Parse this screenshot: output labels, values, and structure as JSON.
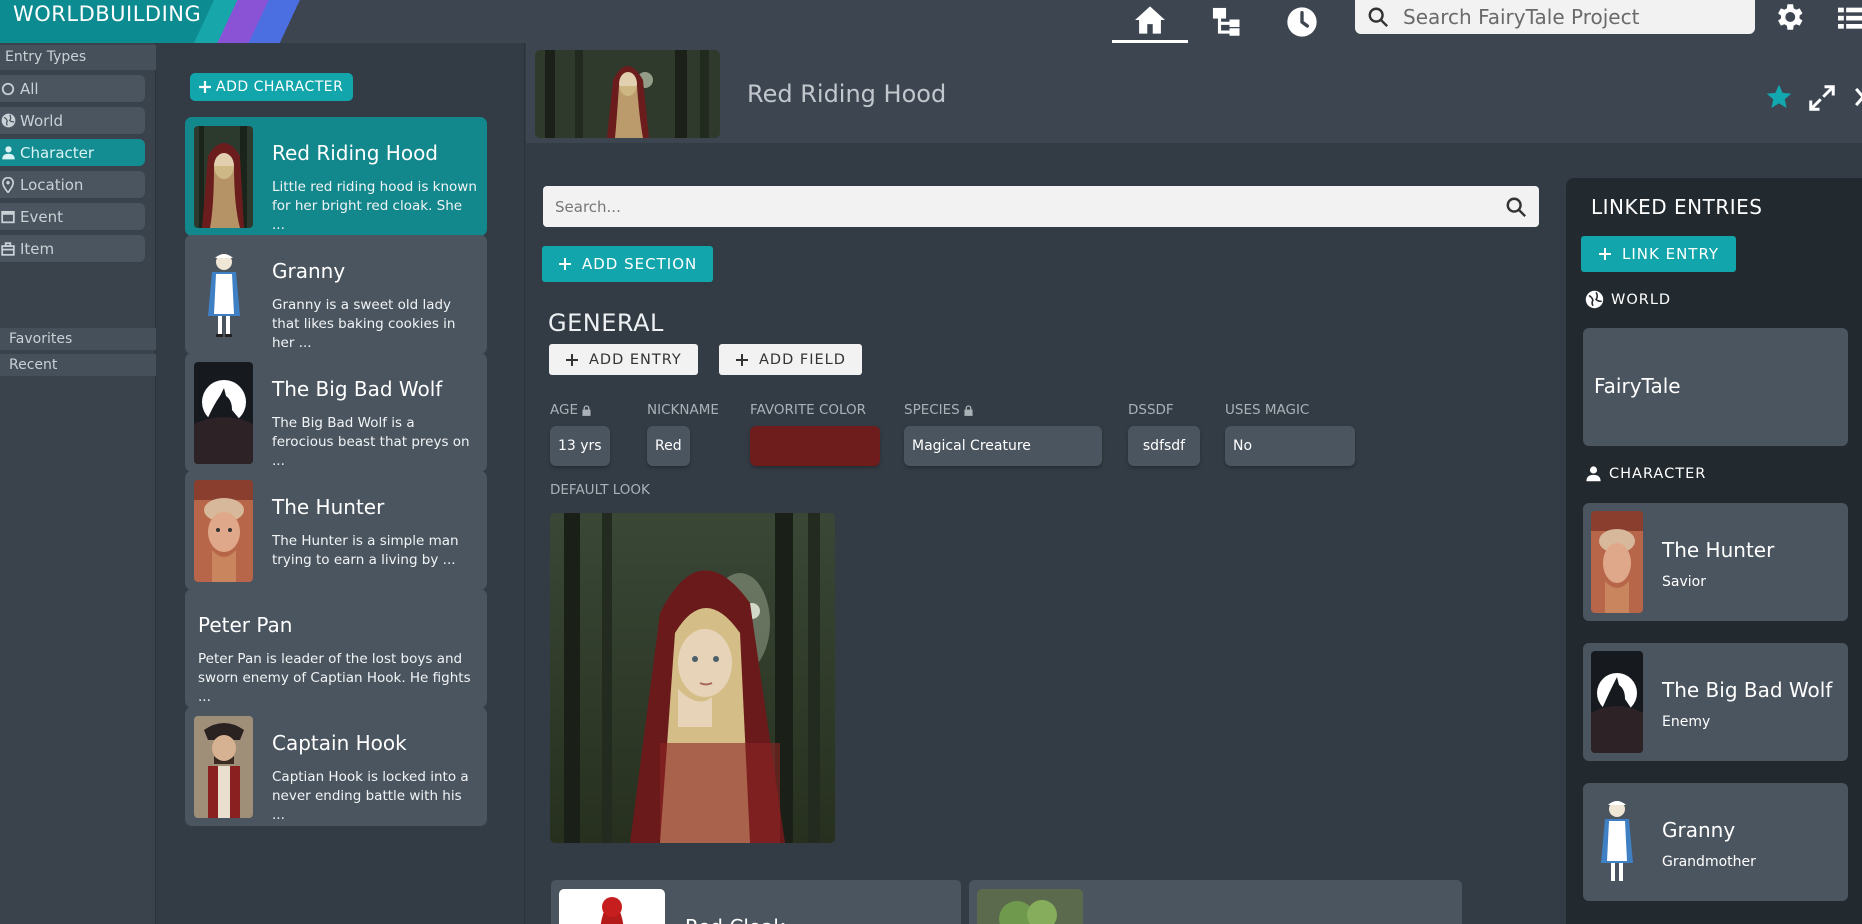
{
  "app": {
    "title": "WORLDBUILDING"
  },
  "topbar": {
    "nav": [
      {
        "name": "home",
        "icon": "home-icon"
      },
      {
        "name": "tree",
        "icon": "tree-icon"
      },
      {
        "name": "history",
        "icon": "clock-icon"
      }
    ],
    "search_placeholder": "Search FairyTale Project",
    "settings_icon": "gear-icon"
  },
  "sidebar": {
    "entry_types_label": "Entry Types",
    "types": [
      {
        "label": "All",
        "icon": "all-icon",
        "active": false
      },
      {
        "label": "World",
        "icon": "globe-icon",
        "active": false
      },
      {
        "label": "Character",
        "icon": "person-icon",
        "active": true
      },
      {
        "label": "Location",
        "icon": "pin-icon",
        "active": false
      },
      {
        "label": "Event",
        "icon": "calendar-icon",
        "active": false
      },
      {
        "label": "Item",
        "icon": "item-icon",
        "active": false
      }
    ],
    "favorites_label": "Favorites",
    "recent_label": "Recent"
  },
  "entries": {
    "add_button_label": "ADD CHARACTER",
    "items": [
      {
        "name": "Red Riding Hood",
        "desc": "Little red riding hood is known for her bright red cloak. She ...",
        "active": true
      },
      {
        "name": "Granny",
        "desc": "Granny is a sweet old lady that likes baking cookies in her ...",
        "active": false
      },
      {
        "name": "The Big Bad Wolf",
        "desc": "The Big Bad Wolf is a ferocious beast that preys on ...",
        "active": false
      },
      {
        "name": "The Hunter",
        "desc": "The Hunter is a simple man trying to earn a living by ...",
        "active": false
      },
      {
        "name": "Peter Pan",
        "desc": "Peter Pan is leader of the lost boys and sworn enemy of Captian Hook. He fights ...",
        "active": false
      },
      {
        "name": "Captain Hook",
        "desc": "Captian Hook is locked into a never ending battle with his ...",
        "active": false
      }
    ]
  },
  "entry": {
    "title": "Red Riding Hood",
    "search_placeholder": "Search...",
    "add_section_label": "ADD SECTION",
    "section": {
      "title": "GENERAL",
      "add_entry_label": "ADD ENTRY",
      "add_field_label": "ADD FIELD",
      "fields": [
        {
          "label": "AGE",
          "value": "13 yrs",
          "locked": true
        },
        {
          "label": "NICKNAME",
          "value": "Red",
          "locked": false
        },
        {
          "label": "FAVORITE COLOR",
          "value": "",
          "color": "#6e1c1c",
          "locked": false
        },
        {
          "label": "SPECIES",
          "value": "Magical Creature",
          "locked": true
        },
        {
          "label": "DSSDF",
          "value": "sdfsdf",
          "locked": false
        },
        {
          "label": "USES MAGIC",
          "value": "No",
          "locked": false
        }
      ],
      "default_look_label": "DEFAULT LOOK"
    },
    "bottom_items": [
      {
        "name": "Red Cloak"
      },
      {
        "name": ""
      }
    ]
  },
  "linked": {
    "title": "LINKED ENTRIES",
    "link_button_label": "LINK ENTRY",
    "world_label": "WORLD",
    "world": {
      "name": "FairyTale"
    },
    "character_label": "CHARACTER",
    "characters": [
      {
        "name": "The Hunter",
        "role": "Savior"
      },
      {
        "name": "The Big Bad Wolf",
        "role": "Enemy"
      },
      {
        "name": "Granny",
        "role": "Grandmother"
      }
    ]
  },
  "colors": {
    "accent": "#12a5ac",
    "active_card": "#12878c",
    "background": "#333b44",
    "card": "#4b555f",
    "panel": "#22292f",
    "favorite_color": "#6e1c1c"
  }
}
